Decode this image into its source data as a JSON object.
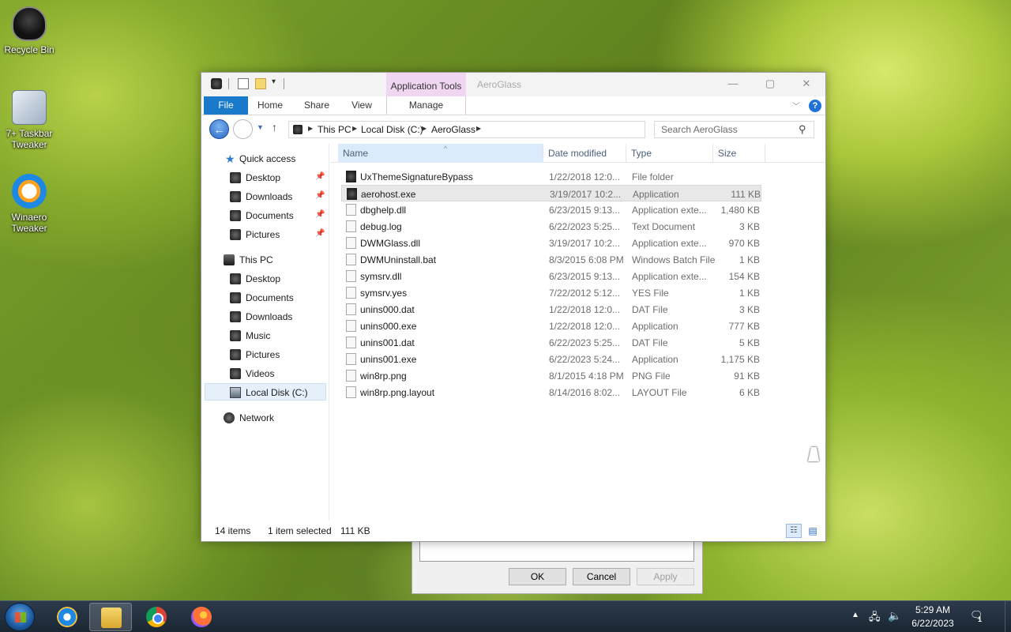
{
  "desktop": {
    "icons": [
      {
        "label": "Recycle Bin"
      },
      {
        "label": "7+ Taskbar Tweaker"
      },
      {
        "label": "Winaero Tweaker"
      }
    ]
  },
  "window": {
    "title": "AeroGlass",
    "context_tab": "Application Tools"
  },
  "ribbon": {
    "tabs": [
      "File",
      "Home",
      "Share",
      "View",
      "Manage"
    ]
  },
  "address": {
    "crumbs": [
      "This PC",
      "Local Disk (C:)",
      "AeroGlass"
    ],
    "search_placeholder": "Search AeroGlass"
  },
  "nav": {
    "quick_access": "Quick access",
    "quick_items": [
      "Desktop",
      "Downloads",
      "Documents",
      "Pictures"
    ],
    "this_pc": "This PC",
    "pc_items": [
      "Desktop",
      "Documents",
      "Downloads",
      "Music",
      "Pictures",
      "Videos",
      "Local Disk (C:)"
    ],
    "network": "Network"
  },
  "columns": {
    "name": "Name",
    "date": "Date modified",
    "type": "Type",
    "size": "Size"
  },
  "files": [
    {
      "name": "UxThemeSignatureBypass",
      "date": "1/22/2018 12:0...",
      "type": "File folder",
      "size": ""
    },
    {
      "name": "aerohost.exe",
      "date": "3/19/2017 10:2...",
      "type": "Application",
      "size": "111 KB"
    },
    {
      "name": "dbghelp.dll",
      "date": "6/23/2015 9:13...",
      "type": "Application exte...",
      "size": "1,480 KB"
    },
    {
      "name": "debug.log",
      "date": "6/22/2023 5:25...",
      "type": "Text Document",
      "size": "3 KB"
    },
    {
      "name": "DWMGlass.dll",
      "date": "3/19/2017 10:2...",
      "type": "Application exte...",
      "size": "970 KB"
    },
    {
      "name": "DWMUninstall.bat",
      "date": "8/3/2015 6:08 PM",
      "type": "Windows Batch File",
      "size": "1 KB"
    },
    {
      "name": "symsrv.dll",
      "date": "6/23/2015 9:13...",
      "type": "Application exte...",
      "size": "154 KB"
    },
    {
      "name": "symsrv.yes",
      "date": "7/22/2012 5:12...",
      "type": "YES File",
      "size": "1 KB"
    },
    {
      "name": "unins000.dat",
      "date": "1/22/2018 12:0...",
      "type": "DAT File",
      "size": "3 KB"
    },
    {
      "name": "unins000.exe",
      "date": "1/22/2018 12:0...",
      "type": "Application",
      "size": "777 KB"
    },
    {
      "name": "unins001.dat",
      "date": "6/22/2023 5:25...",
      "type": "DAT File",
      "size": "5 KB"
    },
    {
      "name": "unins001.exe",
      "date": "6/22/2023 5:24...",
      "type": "Application",
      "size": "1,175 KB"
    },
    {
      "name": "win8rp.png",
      "date": "8/1/2015 4:18 PM",
      "type": "PNG File",
      "size": "91 KB"
    },
    {
      "name": "win8rp.png.layout",
      "date": "8/14/2016 8:02...",
      "type": "LAYOUT File",
      "size": "6 KB"
    }
  ],
  "status": {
    "count": "14 items",
    "selected": "1 item selected",
    "size": "111 KB"
  },
  "dialog": {
    "ok": "OK",
    "cancel": "Cancel",
    "apply": "Apply"
  },
  "taskbar": {
    "time": "5:29 AM",
    "date": "6/22/2023",
    "notification_count": "1"
  }
}
